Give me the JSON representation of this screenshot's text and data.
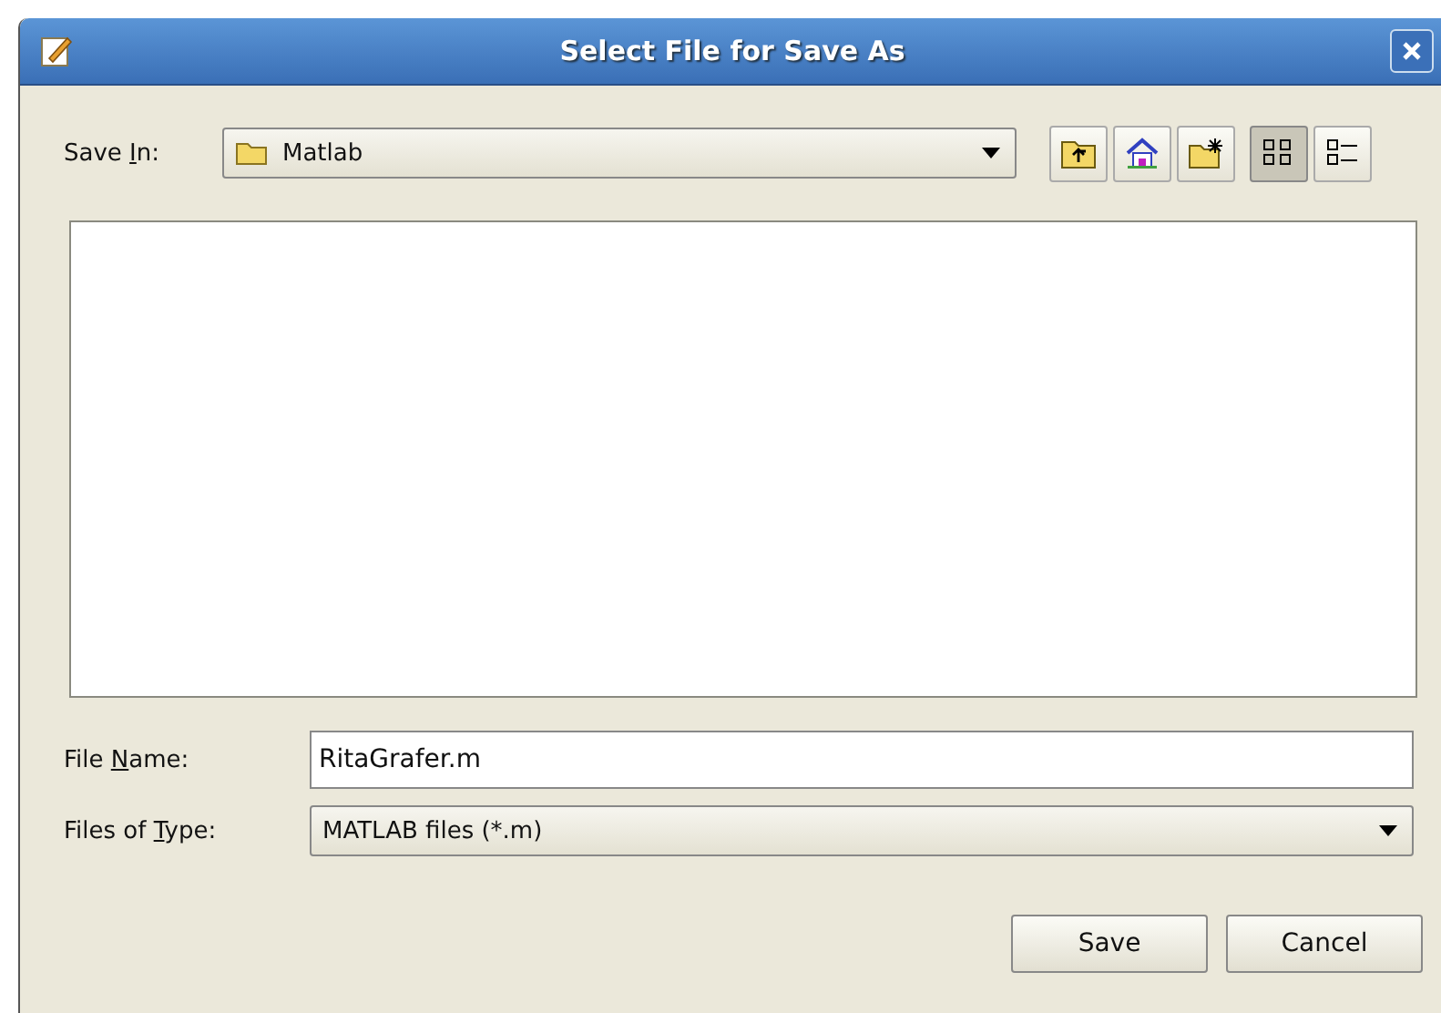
{
  "window": {
    "title": "Select File for Save As"
  },
  "save_in": {
    "label": {
      "before": "Save ",
      "key": "I",
      "after": "n:"
    },
    "value": "Matlab"
  },
  "toolbar": [
    {
      "kind": "up"
    },
    {
      "kind": "home"
    },
    {
      "kind": "newfolder"
    },
    {
      "kind": "list",
      "selected": true
    },
    {
      "kind": "details",
      "selected": false
    }
  ],
  "file_name": {
    "label": {
      "before": "File ",
      "key": "N",
      "after": "ame:"
    },
    "value": "RitaGrafer.m"
  },
  "file_type": {
    "label": {
      "before": "Files of ",
      "key": "T",
      "after": "ype:"
    },
    "value": "MATLAB files (*.m)"
  },
  "buttons": [
    "Save",
    "Cancel"
  ]
}
